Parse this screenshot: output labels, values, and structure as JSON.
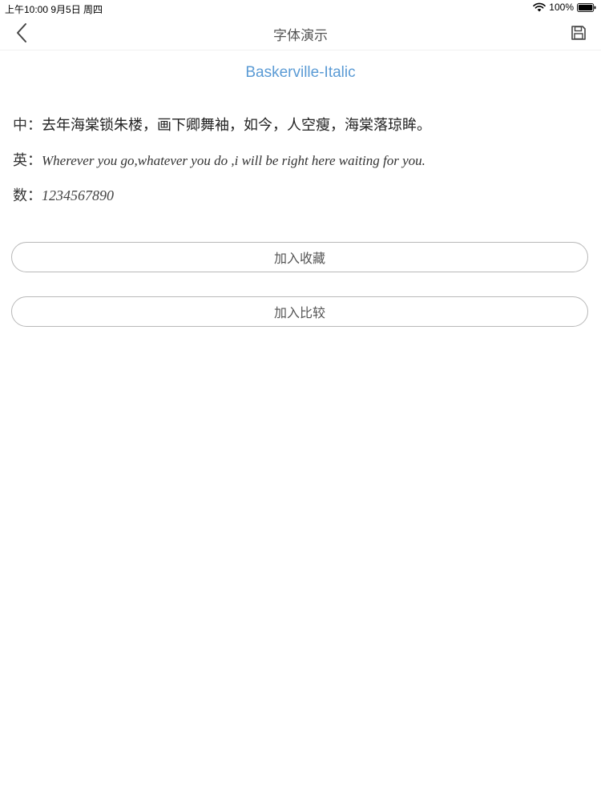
{
  "status_bar": {
    "time": "上午10:00   9月5日 周四",
    "battery": "100%"
  },
  "nav": {
    "title": "字体演示",
    "back_icon": "chevron-left-icon",
    "save_icon": "floppy-disk-icon"
  },
  "font_name": "Baskerville-Italic",
  "samples": {
    "chinese_label": "中：",
    "chinese_text": "去年海棠锁朱楼，画下卿舞袖，如今，人空瘦，海棠落琼眸。",
    "english_label": "英：",
    "english_text": "Wherever you go,whatever you do ,i will be right here waiting for you.",
    "digits_label": "数：",
    "digits_text": "1234567890"
  },
  "buttons": {
    "favorite_label": "加入收藏",
    "compare_label": "加入比较"
  },
  "colors": {
    "accent": "#5b9bd5",
    "button_border": "#b8b8b8"
  }
}
